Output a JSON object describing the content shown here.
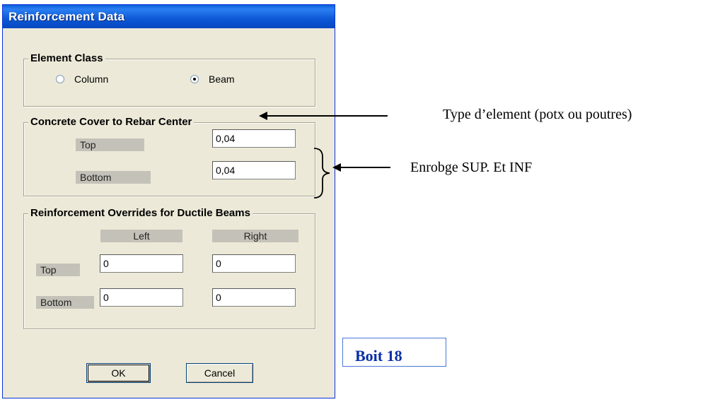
{
  "window": {
    "title": "Reinforcement Data"
  },
  "element_class": {
    "legend": "Element Class",
    "options": [
      {
        "label": "Column",
        "checked": false
      },
      {
        "label": "Beam",
        "checked": true
      }
    ]
  },
  "concrete_cover": {
    "legend": "Concrete Cover to Rebar Center",
    "top_label": "Top",
    "top_value": "0,04",
    "bottom_label": "Bottom",
    "bottom_value": "0,04"
  },
  "overrides": {
    "legend": "Reinforcement Overrides for Ductile Beams",
    "col_left": "Left",
    "col_right": "Right",
    "row_top": "Top",
    "row_bottom": "Bottom",
    "top_left": "0",
    "top_right": "0",
    "bottom_left": "0",
    "bottom_right": "0"
  },
  "buttons": {
    "ok": "OK",
    "cancel": "Cancel"
  },
  "annotations": {
    "element_type": "Type d’element (potx ou poutres)",
    "cover": "Enrobge SUP. Et INF",
    "box_label": "Boit 18"
  },
  "colors": {
    "title_bar": "#0d58d6",
    "dialog_bg": "#ece9d8",
    "boit_text": "#0a2fa6"
  }
}
